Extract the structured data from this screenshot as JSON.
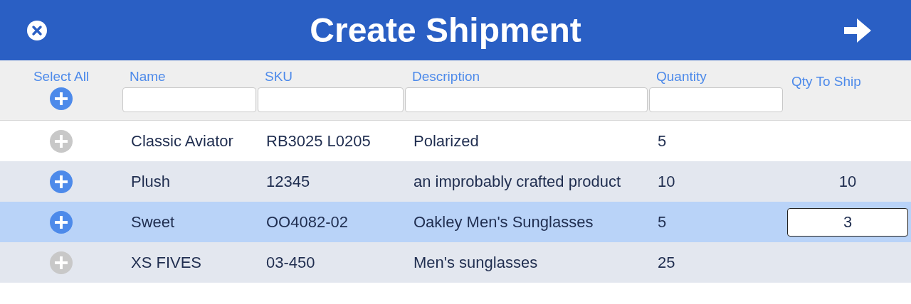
{
  "header": {
    "title": "Create Shipment"
  },
  "select_all": {
    "label": "Select All"
  },
  "columns": [
    {
      "label": "Name",
      "filterable": true
    },
    {
      "label": "SKU",
      "filterable": true
    },
    {
      "label": "Description",
      "filterable": true
    },
    {
      "label": "Quantity",
      "filterable": true
    },
    {
      "label": "Qty To Ship",
      "filterable": false
    }
  ],
  "rows": [
    {
      "enabled": false,
      "selected": false,
      "name": "Classic Aviator",
      "sku": "RB3025 L0205",
      "description": "Polarized",
      "quantity": "5"
    },
    {
      "enabled": true,
      "selected": false,
      "name": "Plush",
      "sku": "12345",
      "description": "an improbably crafted product",
      "quantity": "10",
      "qty_to_ship": {
        "kind": "text",
        "value": "10"
      }
    },
    {
      "enabled": true,
      "selected": true,
      "name": "Sweet",
      "sku": "OO4082-02",
      "description": "Oakley Men's Sunglasses",
      "quantity": "5",
      "qty_to_ship": {
        "kind": "input",
        "value": "3"
      }
    },
    {
      "enabled": false,
      "selected": false,
      "name": "XS FIVES",
      "sku": "03-450",
      "description": "Men's sunglasses",
      "quantity": "25"
    }
  ]
}
